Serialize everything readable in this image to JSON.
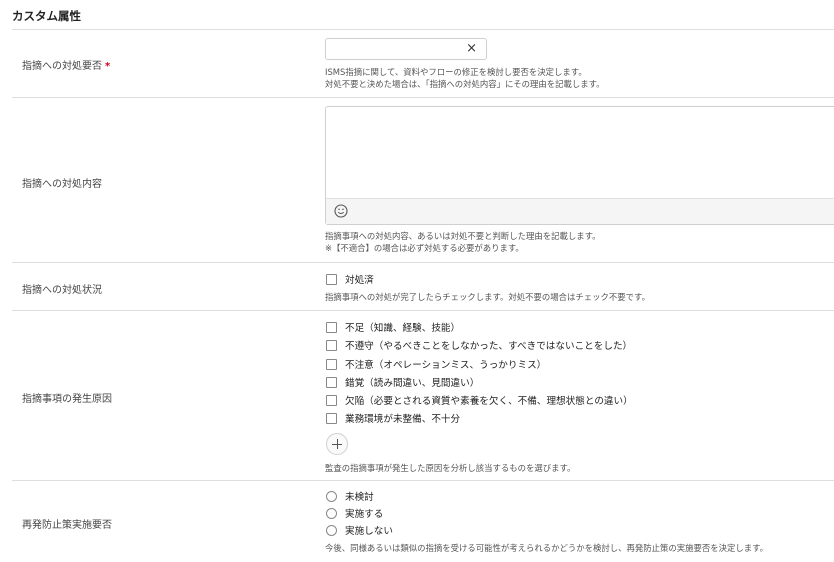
{
  "section": {
    "title": "カスタム属性"
  },
  "fields": {
    "requirement": {
      "label": "指摘への対処要否",
      "required_mark": "*",
      "clear_icon": "×",
      "help1": "ISMS指摘に関して、資料やフローの修正を検討し要否を決定します。",
      "help2": "対処不要と決めた場合は、「指摘への対処内容」にその理由を記載します。"
    },
    "content": {
      "label": "指摘への対処内容",
      "help1": "指摘事項への対処内容、あるいは対処不要と判断した理由を記載します。",
      "help2": "※【不適合】の場合は必ず対処する必要があります。"
    },
    "status": {
      "label": "指摘への対処状況",
      "option": "対処済",
      "help": "指摘事項への対処が完了したらチェックします。対処不要の場合はチェック不要です。"
    },
    "cause": {
      "label": "指摘事項の発生原因",
      "options": [
        "不足（知識、経験、技能）",
        "不遵守（やるべきことをしなかった、すべきではないことをした）",
        "不注意（オペレーションミス、うっかりミス）",
        "錯覚（読み間違い、見間違い）",
        "欠陥（必要とされる資質や素養を欠く、不備、理想状態との違い）",
        "業務環境が未整備、不十分"
      ],
      "help": "監査の指摘事項が発生した原因を分析し該当するものを選びます。"
    },
    "prevention": {
      "label": "再発防止策実施要否",
      "options": [
        "未検討",
        "実施する",
        "実施しない"
      ],
      "help": "今後、同様あるいは類似の指摘を受ける可能性が考えられるかどうかを検討し、再発防止策の実施要否を決定します。"
    }
  }
}
